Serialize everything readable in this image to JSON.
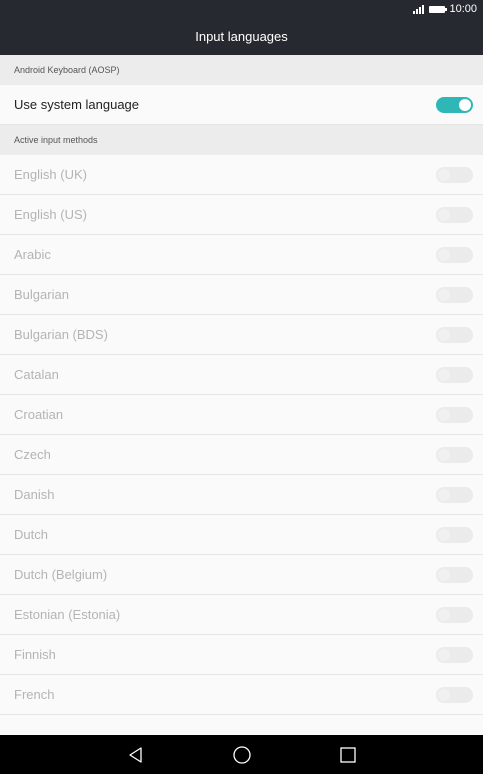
{
  "status_bar": {
    "time": "10:00",
    "signal_icon": "signal-icon",
    "battery_icon": "battery-icon"
  },
  "app_bar": {
    "title": "Input languages"
  },
  "sections": {
    "keyboard_header": "Android Keyboard (AOSP)",
    "use_system_language": {
      "label": "Use system language",
      "enabled": true
    },
    "active_header": "Active input methods"
  },
  "languages": [
    {
      "label": "English (UK)",
      "enabled": false
    },
    {
      "label": "English (US)",
      "enabled": false
    },
    {
      "label": "Arabic",
      "enabled": false
    },
    {
      "label": "Bulgarian",
      "enabled": false
    },
    {
      "label": "Bulgarian (BDS)",
      "enabled": false
    },
    {
      "label": "Catalan",
      "enabled": false
    },
    {
      "label": "Croatian",
      "enabled": false
    },
    {
      "label": "Czech",
      "enabled": false
    },
    {
      "label": "Danish",
      "enabled": false
    },
    {
      "label": "Dutch",
      "enabled": false
    },
    {
      "label": "Dutch (Belgium)",
      "enabled": false
    },
    {
      "label": "Estonian (Estonia)",
      "enabled": false
    },
    {
      "label": "Finnish",
      "enabled": false
    },
    {
      "label": "French",
      "enabled": false
    }
  ],
  "nav_bar": {
    "back_icon": "back-icon",
    "home_icon": "home-icon",
    "recents_icon": "recents-icon"
  },
  "colors": {
    "accent": "#2fb7b7",
    "app_bar": "#262a30",
    "nav_bar": "#000000"
  }
}
